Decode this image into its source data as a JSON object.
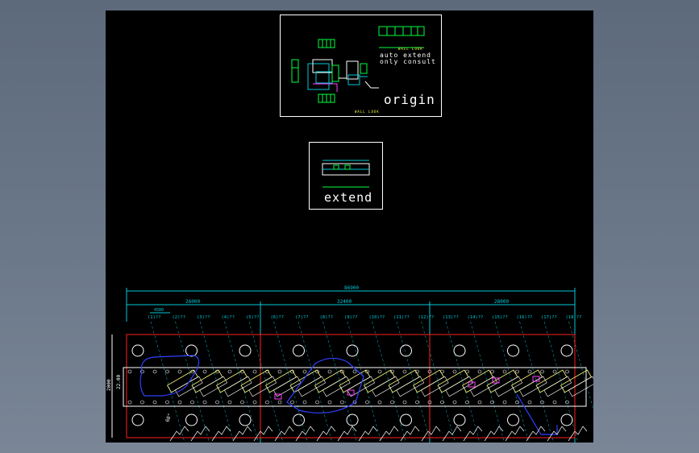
{
  "colors": {
    "background_outer": "#6b7889",
    "canvas": "#000000",
    "frame": "#ffffff",
    "dimension": "#00c8d8",
    "border_red": "#ff2020",
    "hole_white": "#ffffff",
    "beam_yellow": "#ffff80",
    "blue_path": "#3040ff",
    "magenta": "#ff40ff",
    "green": "#00ff40"
  },
  "origin_panel": {
    "title": "origin",
    "note_line1": "auto extend",
    "note_line2": "only consult",
    "small_label": "WALL LOOK",
    "bottom_label": "WALL LOOK"
  },
  "extend_panel": {
    "title": "extend"
  },
  "drawing": {
    "overall_dim": "86900",
    "segment_dims": [
      "26000",
      "32400",
      "28000"
    ],
    "first_step_dim": "4500",
    "height_dims": [
      "2000",
      "22.00"
    ],
    "angle_label": "60°",
    "column_labels": [
      "(1)??",
      "(2)??",
      "(3)??",
      "(4)??",
      "(5)??",
      "(6)??",
      "(7)??",
      "(8)??",
      "(9)??",
      "(10)??",
      "(11)??",
      "(12)??",
      "(13)??",
      "(14)??",
      "(15)??",
      "(16)??",
      "(17)??",
      "(18)??"
    ]
  }
}
